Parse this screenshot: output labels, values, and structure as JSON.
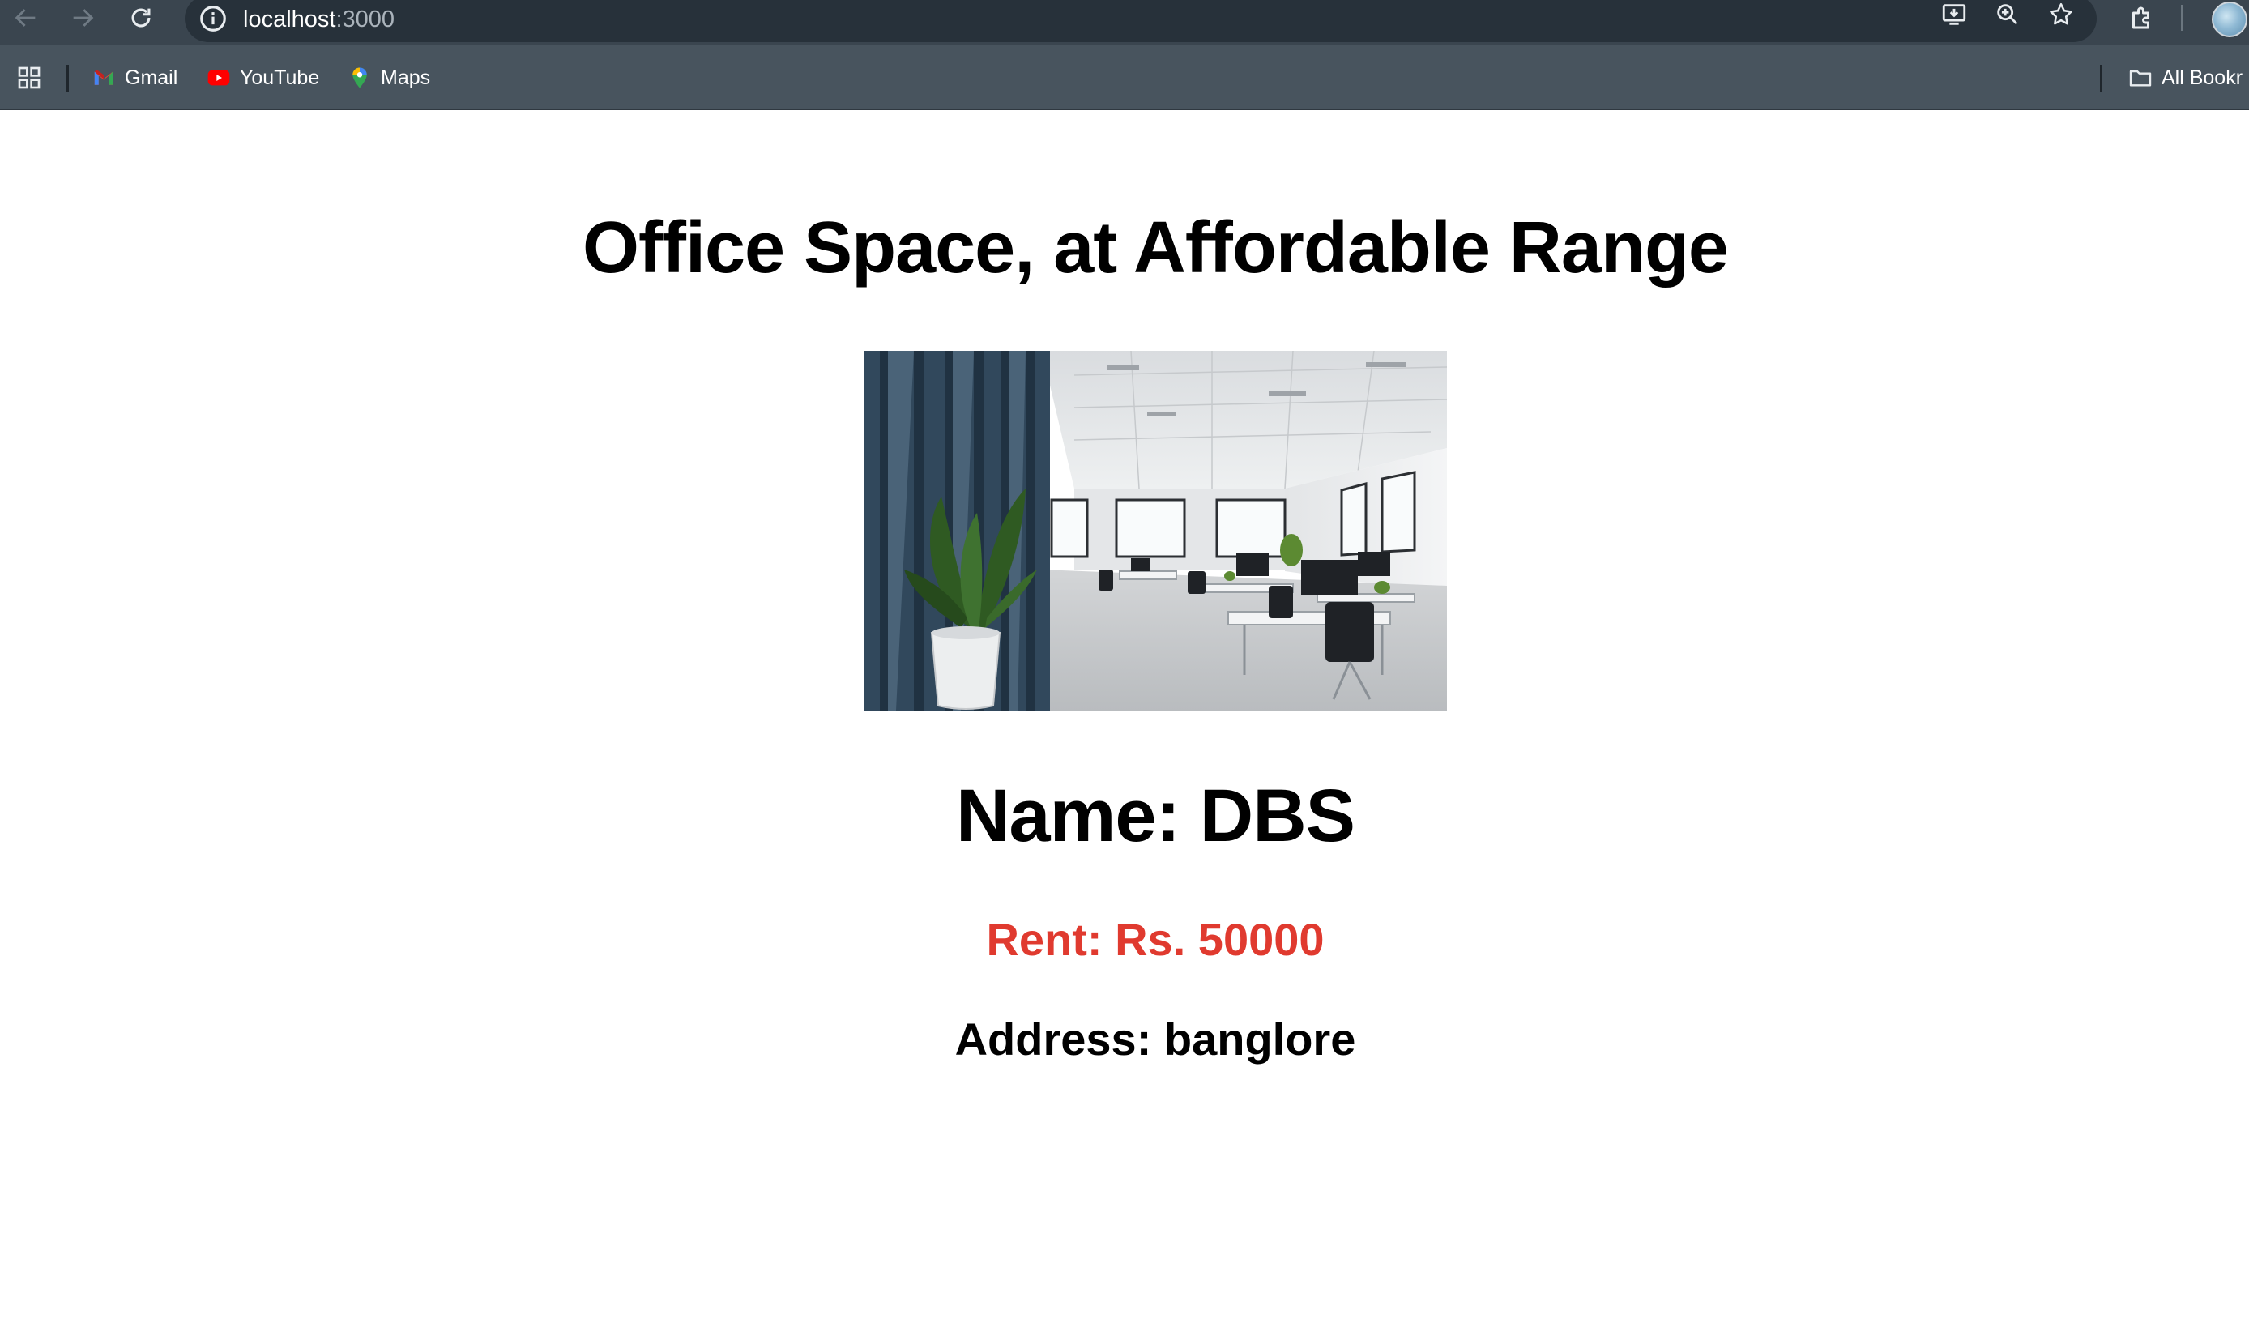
{
  "browser": {
    "url_host": "localhost",
    "url_port": ":3000",
    "bookmarks": [
      {
        "label": "Gmail",
        "icon": "gmail-icon"
      },
      {
        "label": "YouTube",
        "icon": "youtube-icon"
      },
      {
        "label": "Maps",
        "icon": "maps-icon"
      }
    ],
    "all_bookmarks_label": "All Bookr"
  },
  "page": {
    "title": "Office Space, at Affordable Range",
    "image_alt": "office-space-photo",
    "name": "Name: DBS",
    "rent": "Rent: Rs. 50000",
    "address": "Address: banglore"
  },
  "colors": {
    "toolbar_bg": "#3a454f",
    "bookmarks_bg": "#48545e",
    "rent_text": "#e03a2f"
  }
}
